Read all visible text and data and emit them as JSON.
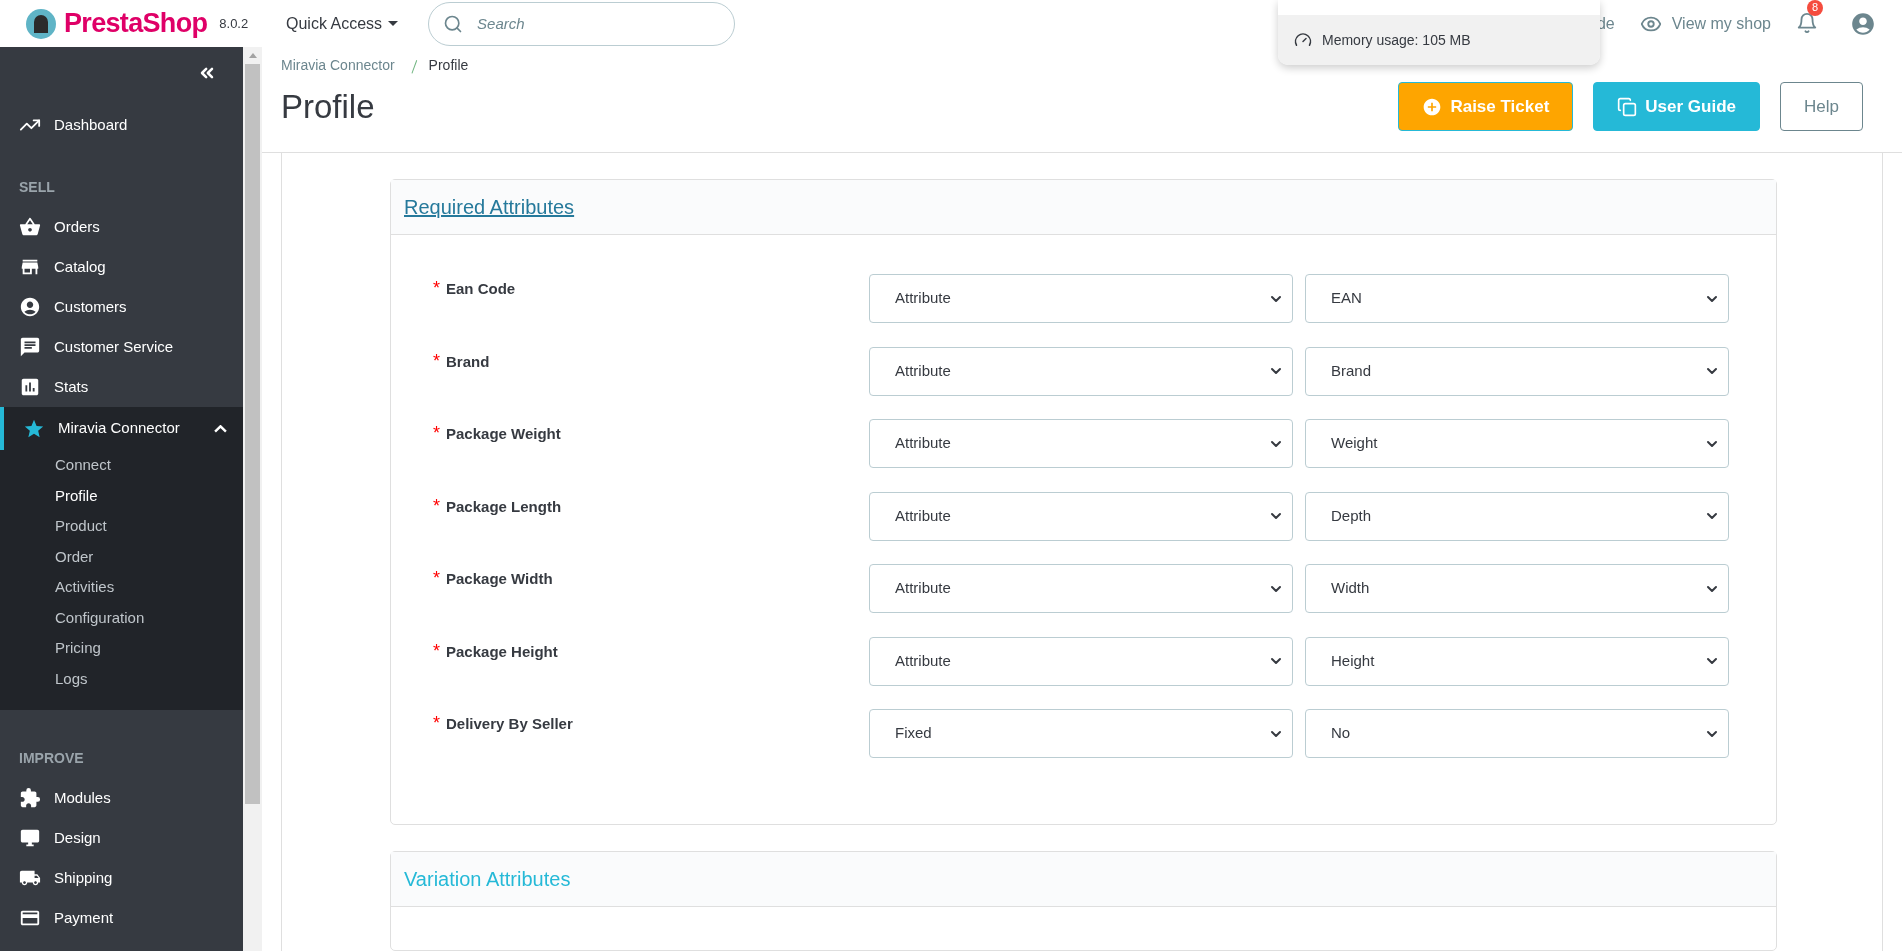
{
  "header": {
    "brand": "PrestaShop",
    "version": "8.0.2",
    "quick_access": "Quick Access",
    "search": {
      "placeholder": "Search"
    },
    "partial_link": "de",
    "view_shop": "View my shop",
    "notifications": "8"
  },
  "popover": {
    "memory": "Memory usage: 105 MB"
  },
  "sidebar": {
    "items": [
      {
        "kind": "link",
        "label": "Dashboard"
      },
      {
        "kind": "section",
        "label": "SELL"
      },
      {
        "kind": "link",
        "label": "Orders"
      },
      {
        "kind": "link",
        "label": "Catalog"
      },
      {
        "kind": "link",
        "label": "Customers"
      },
      {
        "kind": "link",
        "label": "Customer Service"
      },
      {
        "kind": "link",
        "label": "Stats"
      },
      {
        "kind": "group",
        "label": "Miravia Connector",
        "expanded": true,
        "children": [
          {
            "label": "Connect",
            "selected": false
          },
          {
            "label": "Profile",
            "selected": true
          },
          {
            "label": "Product",
            "selected": false
          },
          {
            "label": "Order",
            "selected": false
          },
          {
            "label": "Activities",
            "selected": false
          },
          {
            "label": "Configuration",
            "selected": false
          },
          {
            "label": "Pricing",
            "selected": false
          },
          {
            "label": "Logs",
            "selected": false
          }
        ]
      },
      {
        "kind": "section",
        "label": "IMPROVE"
      },
      {
        "kind": "link",
        "label": "Modules"
      },
      {
        "kind": "link",
        "label": "Design"
      },
      {
        "kind": "link",
        "label": "Shipping"
      },
      {
        "kind": "link",
        "label": "Payment"
      }
    ]
  },
  "breadcrumb": [
    "Miravia Connector",
    "Profile"
  ],
  "title": "Profile",
  "buttons": [
    {
      "kind": "warning",
      "label": "Raise Ticket"
    },
    {
      "kind": "info",
      "label": "User Guide"
    },
    {
      "kind": "outline",
      "label": "Help"
    }
  ],
  "required": {
    "title": "Required Attributes",
    "rows": [
      {
        "mark": "*",
        "label": "Ean Code",
        "source": "Attribute",
        "value": "EAN"
      },
      {
        "mark": "*",
        "label": "Brand",
        "source": "Attribute",
        "value": "Brand"
      },
      {
        "mark": "*",
        "label": "Package Weight",
        "source": "Attribute",
        "value": "Weight"
      },
      {
        "mark": "*",
        "label": "Package Length",
        "source": "Attribute",
        "value": "Depth"
      },
      {
        "mark": "*",
        "label": "Package Width",
        "source": "Attribute",
        "value": "Width"
      },
      {
        "mark": "*",
        "label": "Package Height",
        "source": "Attribute",
        "value": "Height"
      },
      {
        "mark": "*",
        "label": "Delivery By Seller",
        "source": "Fixed",
        "value": "No"
      }
    ]
  },
  "variation": {
    "title": "Variation Attributes"
  }
}
